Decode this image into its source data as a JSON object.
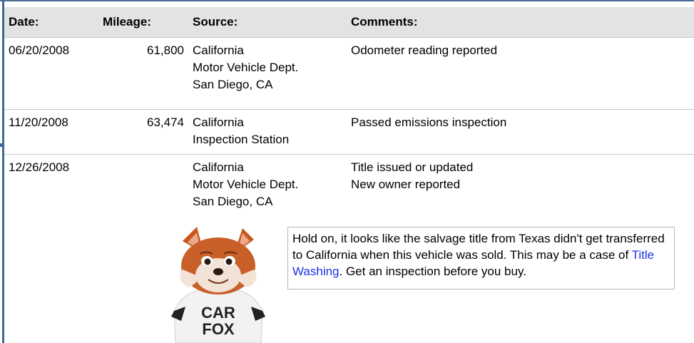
{
  "table": {
    "headers": {
      "date": "Date:",
      "mileage": "Mileage:",
      "source": "Source:",
      "comments": "Comments:"
    },
    "rows": [
      {
        "date": "06/20/2008",
        "mileage": "61,800",
        "source": [
          "California",
          "Motor Vehicle Dept.",
          "San Diego, CA"
        ],
        "comments": [
          "Odometer reading reported"
        ]
      },
      {
        "date": "11/20/2008",
        "mileage": "63,474",
        "source": [
          "California",
          "Inspection Station"
        ],
        "comments": [
          "Passed emissions inspection"
        ]
      },
      {
        "date": "12/26/2008",
        "mileage": "",
        "source": [
          "California",
          "Motor Vehicle Dept.",
          "San Diego, CA"
        ],
        "comments": [
          "Title issued or updated",
          "New owner reported"
        ]
      }
    ]
  },
  "callout": {
    "text_before": "Hold on, it looks like the salvage title from Texas didn't get transferred to California when this vehicle was sold. This may be a case of ",
    "link": "Title Washing",
    "text_after": ". Get an inspection before you buy.",
    "link_color": "#1a34e6"
  },
  "mascot": {
    "icon": "carfox-mascot-icon",
    "shirt_line1": "CAR",
    "shirt_line2": "FOX"
  }
}
